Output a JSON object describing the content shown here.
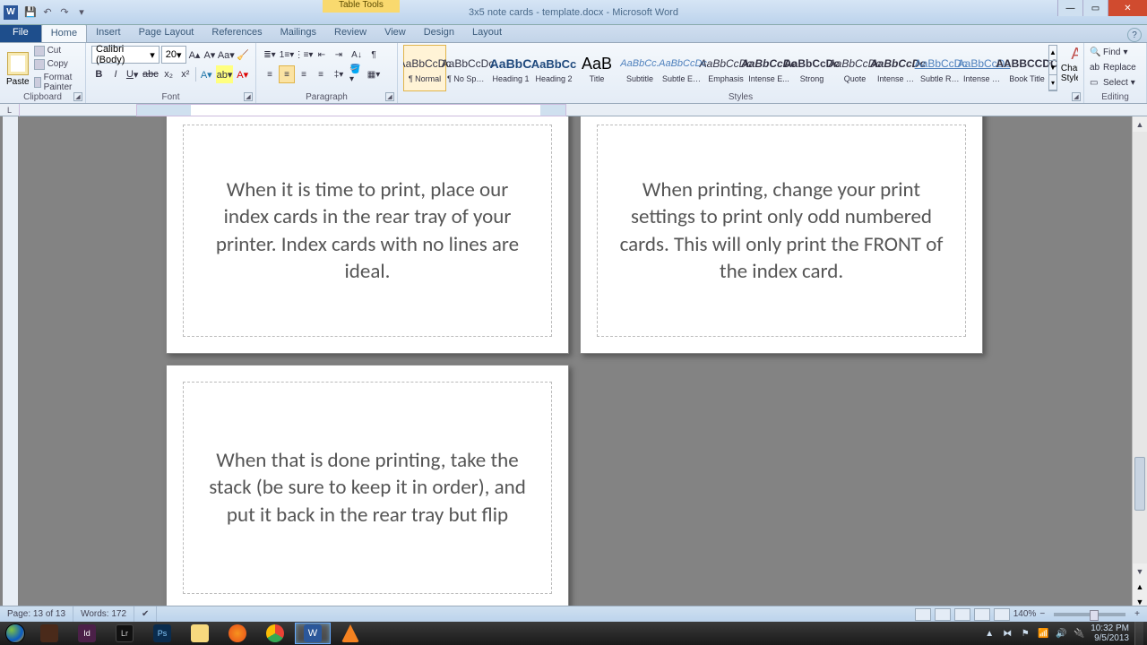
{
  "title_bar": {
    "tool_context": "Table Tools",
    "doc_title": "3x5 note cards - template.docx - Microsoft Word",
    "qat": [
      "save",
      "undo",
      "redo"
    ]
  },
  "tabs": {
    "file": "File",
    "items": [
      "Home",
      "Insert",
      "Page Layout",
      "References",
      "Mailings",
      "Review",
      "View"
    ],
    "active": "Home",
    "context": [
      "Design",
      "Layout"
    ]
  },
  "ribbon": {
    "clipboard": {
      "label": "Clipboard",
      "paste": "Paste",
      "cut": "Cut",
      "copy": "Copy",
      "fmt": "Format Painter"
    },
    "font": {
      "label": "Font",
      "name": "Calibri (Body)",
      "size": "20"
    },
    "paragraph": {
      "label": "Paragraph"
    },
    "styles": {
      "label": "Styles",
      "change": "Change Styles",
      "items": [
        {
          "prev": "AaBbCcDc",
          "name": "¶ Normal",
          "cls": "",
          "sel": true
        },
        {
          "prev": "AaBbCcDc",
          "name": "¶ No Spaci...",
          "cls": ""
        },
        {
          "prev": "AaBbC",
          "name": "Heading 1",
          "cls": "h1"
        },
        {
          "prev": "AaBbCc",
          "name": "Heading 2",
          "cls": "h2"
        },
        {
          "prev": "AaB",
          "name": "Title",
          "cls": "title"
        },
        {
          "prev": "AaBbCc.",
          "name": "Subtitle",
          "cls": "sub"
        },
        {
          "prev": "AaBbCcDc",
          "name": "Subtle Em...",
          "cls": "sub"
        },
        {
          "prev": "AaBbCcDc",
          "name": "Emphasis",
          "cls": "emp"
        },
        {
          "prev": "AaBbCcDc",
          "name": "Intense E...",
          "cls": "ie"
        },
        {
          "prev": "AaBbCcDc",
          "name": "Strong",
          "cls": "str"
        },
        {
          "prev": "AaBbCcDc",
          "name": "Quote",
          "cls": "emp"
        },
        {
          "prev": "AaBbCcDc",
          "name": "Intense Q...",
          "cls": "ie"
        },
        {
          "prev": "AaBbCcDc",
          "name": "Subtle Ref...",
          "cls": "u"
        },
        {
          "prev": "AaBbCcDc",
          "name": "Intense R...",
          "cls": "u"
        },
        {
          "prev": "AABBCCDC",
          "name": "Book Title",
          "cls": "book"
        }
      ]
    },
    "editing": {
      "label": "Editing",
      "find": "Find",
      "replace": "Replace",
      "select": "Select"
    }
  },
  "cards": [
    "When it is time to print, place our index cards in the rear tray of your printer.  Index cards with no lines are ideal.",
    "When printing, change your print settings to print only odd numbered cards.  This will only print the FRONT of the index card.",
    "When that is done printing, take the stack (be sure to keep it in order), and put it back in the rear tray but flip"
  ],
  "status": {
    "page": "Page: 13 of 13",
    "words": "Words: 172",
    "zoom": "140%"
  },
  "tray": {
    "time": "10:32 PM",
    "date": "9/5/2013"
  }
}
